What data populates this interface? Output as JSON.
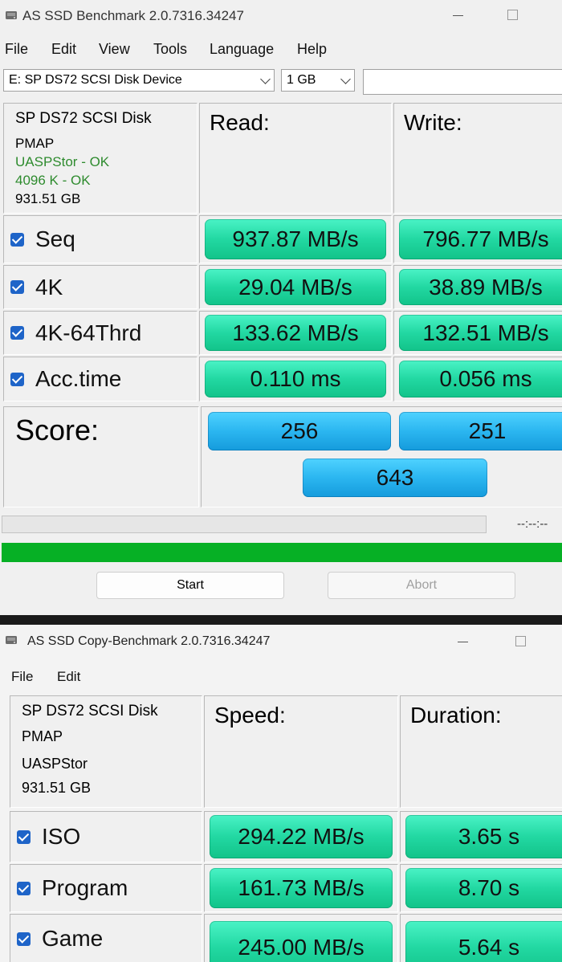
{
  "bench": {
    "title": "AS SSD Benchmark 2.0.7316.34247",
    "menu": [
      "File",
      "Edit",
      "View",
      "Tools",
      "Language",
      "Help"
    ],
    "drive_select": "E: SP DS72 SCSI Disk Device",
    "size_select": "1 GB",
    "drive_info": {
      "name": "SP DS72 SCSI Disk",
      "fw": "PMAP",
      "driver": "UASPStor - OK",
      "align": "4096 K - OK",
      "capacity": "931.51 GB"
    },
    "read_label": "Read:",
    "write_label": "Write:",
    "rows": [
      {
        "label": "Seq",
        "read": "937.87 MB/s",
        "write": "796.77 MB/s"
      },
      {
        "label": "4K",
        "read": "29.04 MB/s",
        "write": "38.89 MB/s"
      },
      {
        "label": "4K-64Thrd",
        "read": "133.62 MB/s",
        "write": "132.51 MB/s"
      },
      {
        "label": "Acc.time",
        "read": "0.110 ms",
        "write": "0.056 ms"
      }
    ],
    "score_label": "Score:",
    "score_read": "256",
    "score_write": "251",
    "score_total": "643",
    "timer": "--:--:--",
    "progress": 1.0,
    "start_label": "Start",
    "abort_label": "Abort"
  },
  "copy": {
    "title": "AS SSD Copy-Benchmark 2.0.7316.34247",
    "menu": [
      "File",
      "Edit"
    ],
    "drive_info": {
      "name": "SP DS72 SCSI Disk",
      "fw": "PMAP",
      "driver": "UASPStor",
      "capacity": "931.51 GB"
    },
    "speed_label": "Speed:",
    "duration_label": "Duration:",
    "rows": [
      {
        "label": "ISO",
        "speed": "294.22 MB/s",
        "duration": "3.65 s"
      },
      {
        "label": "Program",
        "speed": "161.73 MB/s",
        "duration": "8.70 s"
      },
      {
        "label": "Game",
        "speed": "245.00 MB/s",
        "duration": "5.64 s"
      }
    ]
  },
  "colors": {
    "value_green": "#22d8a2",
    "score_blue": "#2bb6f0",
    "progress_green": "#06b025",
    "ok_text": "#2e8b2e",
    "checkbox_blue": "#1e64c8"
  },
  "icons": [
    "disk-icon",
    "minimize-icon",
    "maximize-icon",
    "checkbox-icon",
    "dropdown-arrow-icon"
  ]
}
